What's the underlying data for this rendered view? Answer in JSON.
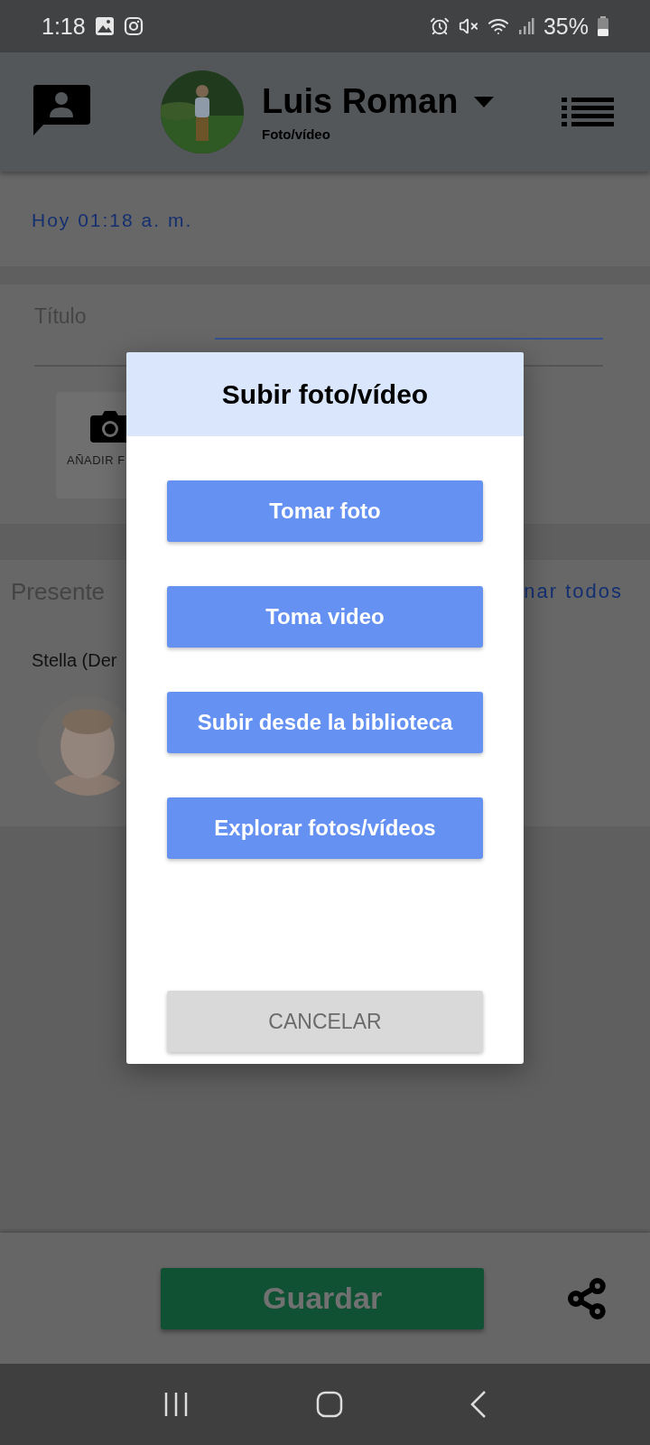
{
  "status_bar": {
    "time": "1:18",
    "battery": "35%"
  },
  "header": {
    "name": "Luis Roman",
    "subtitle": "Foto/vídeo"
  },
  "date": "Hoy 01:18 a. m.",
  "title_field": {
    "label": "Título"
  },
  "add_media": {
    "label": "AÑADIR F"
  },
  "attendance": {
    "title": "Presente",
    "action": "nar todos",
    "students": [
      {
        "name": "Stella (Der"
      }
    ]
  },
  "dialog": {
    "title": "Subir foto/vídeo",
    "actions": [
      {
        "label": "Tomar foto",
        "kind": "primary"
      },
      {
        "label": "Toma video",
        "kind": "primary"
      },
      {
        "label": "Subir desde la biblioteca",
        "kind": "primary"
      },
      {
        "label": "Explorar fotos/vídeos",
        "kind": "primary"
      },
      {
        "label": "CANCELAR",
        "kind": "cancel"
      }
    ]
  },
  "footer": {
    "save": "Guardar"
  }
}
